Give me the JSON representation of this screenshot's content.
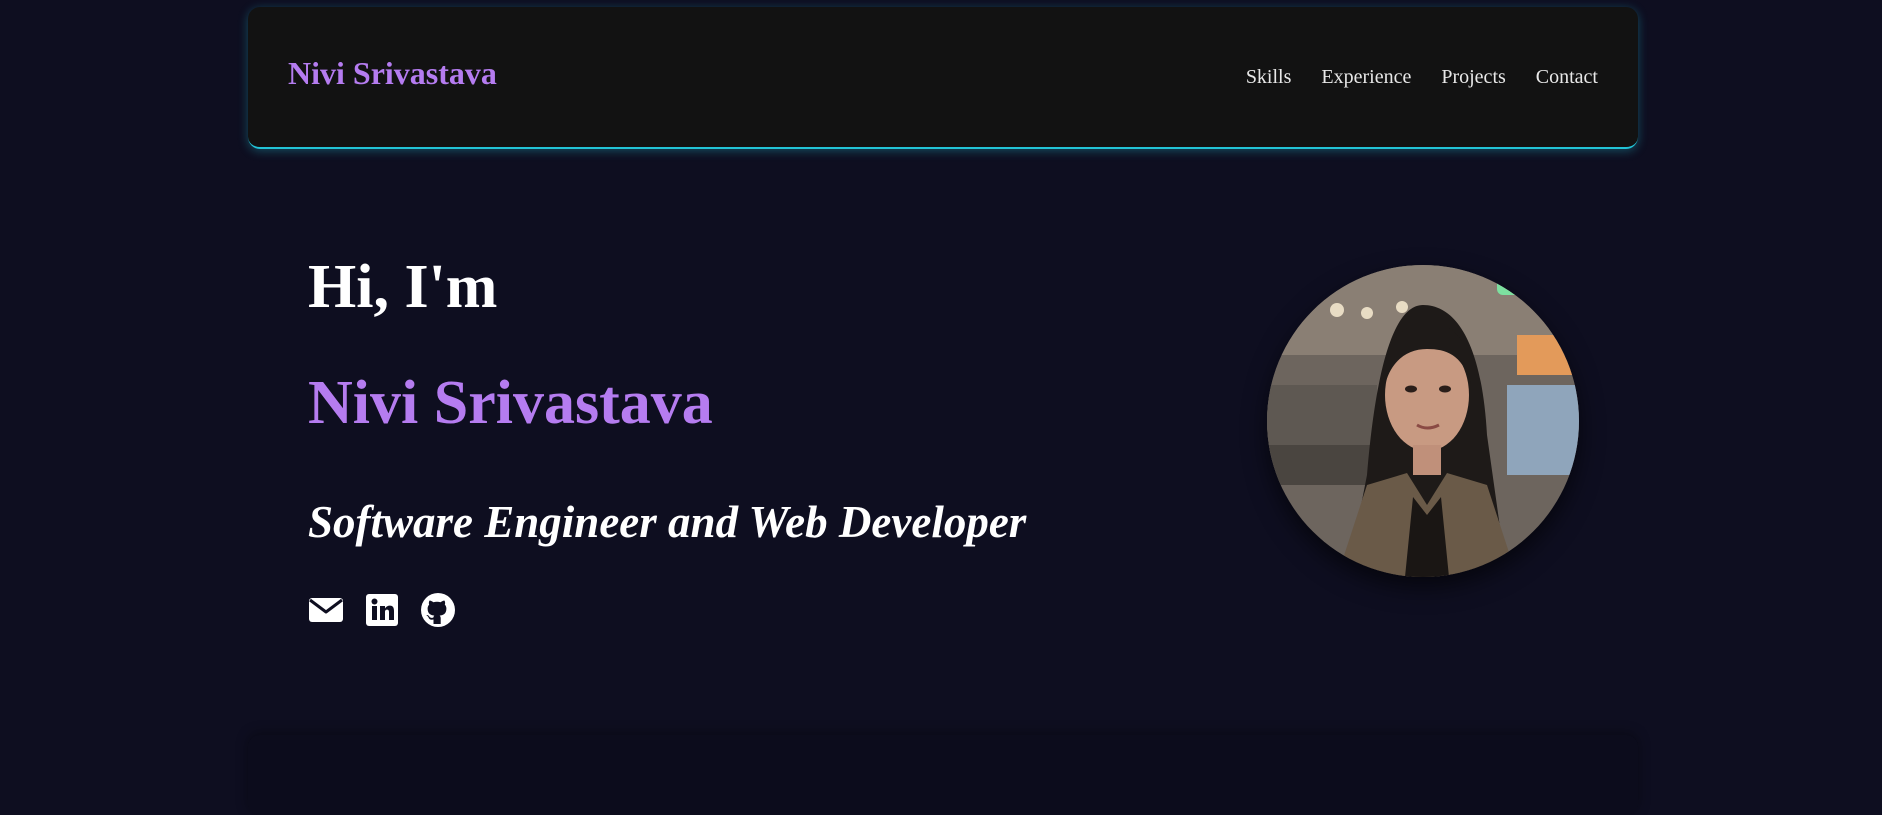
{
  "navbar": {
    "brand": "Nivi Srivastava",
    "links": [
      "Skills",
      "Experience",
      "Projects",
      "Contact"
    ]
  },
  "hero": {
    "greeting": "Hi, I'm",
    "name": "Nivi Srivastava",
    "tagline": "Software Engineer and Web Developer",
    "social_icons": [
      "email-icon",
      "linkedin-icon",
      "github-icon"
    ]
  },
  "colors": {
    "background": "#0e0e20",
    "navbar": "#121212",
    "accent_purple": "#b57cf0",
    "accent_cyan": "#22c3d6",
    "text": "#ffffff"
  }
}
